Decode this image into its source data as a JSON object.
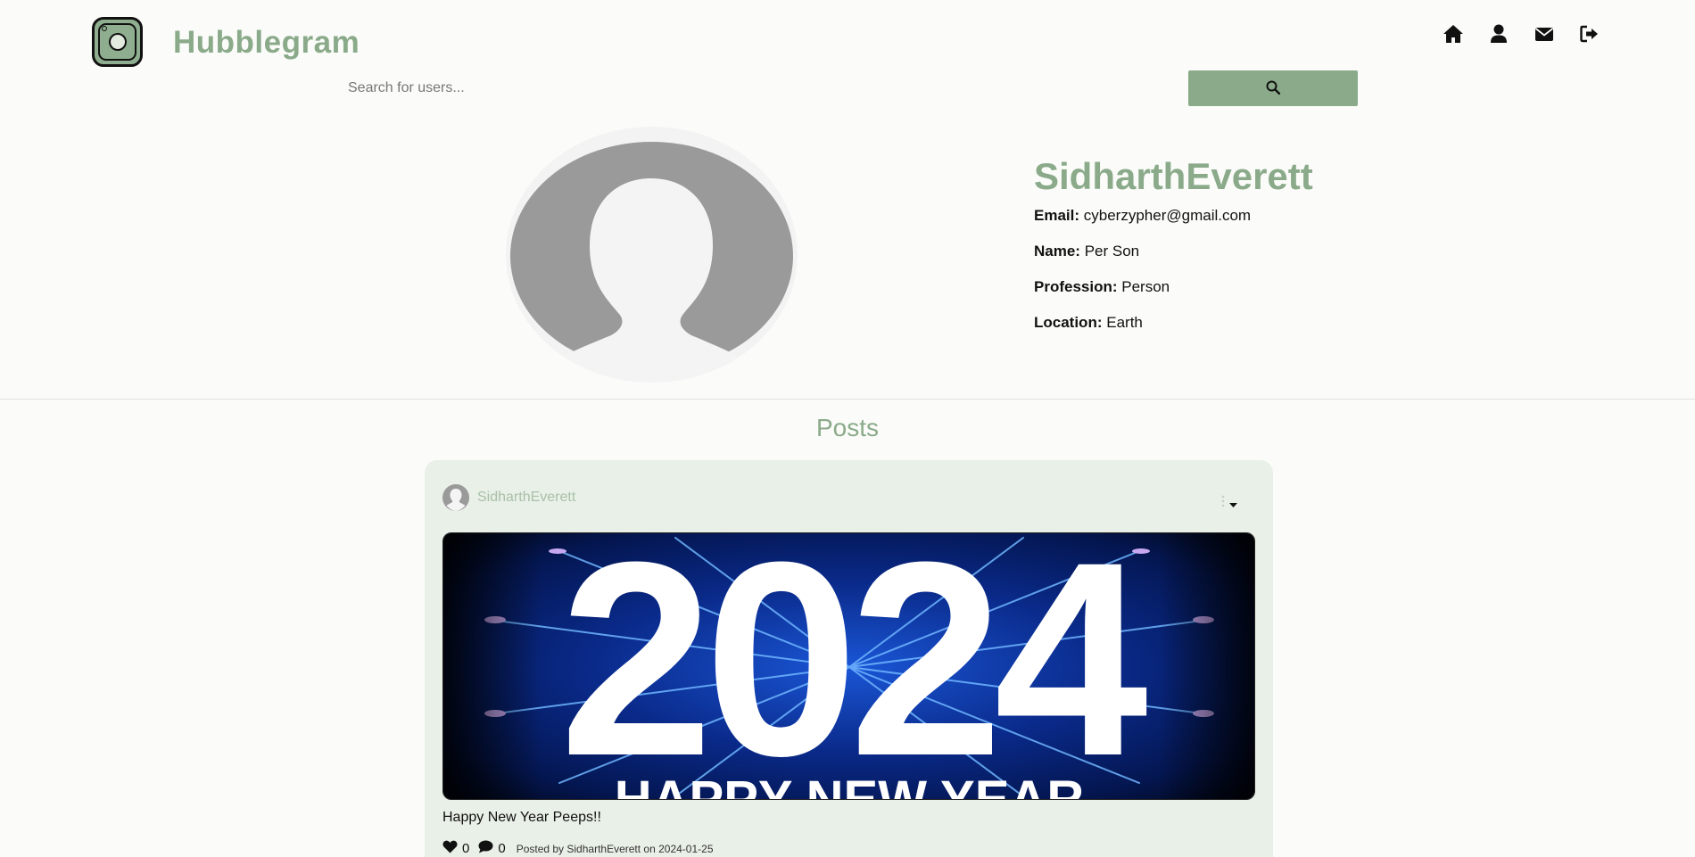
{
  "app": {
    "brand": "Hubblegram",
    "accent_color": "#8aaa8a"
  },
  "nav": {
    "icons": [
      "home-icon",
      "user-icon",
      "envelope-icon",
      "sign-out-icon"
    ]
  },
  "search": {
    "placeholder": "Search for users...",
    "value": "",
    "button_icon": "search-icon"
  },
  "profile": {
    "username": "SidharthEverett",
    "fields": [
      {
        "label": "Email:",
        "value": "cyberzypher@gmail.com"
      },
      {
        "label": "Name:",
        "value": "Per Son"
      },
      {
        "label": "Profession:",
        "value": "Person"
      },
      {
        "label": "Location:",
        "value": "Earth"
      }
    ]
  },
  "posts": {
    "title": "Posts",
    "items": [
      {
        "author": "SidharthEverett",
        "image_text": "2024",
        "image_subtext": "HAPPY NEW YEAR",
        "caption": "Happy New Year Peeps!!",
        "likes": "0",
        "comments": "0",
        "posted_by": "Posted by SidharthEverett on 2024-01-25"
      }
    ]
  }
}
